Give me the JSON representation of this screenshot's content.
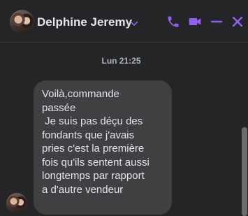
{
  "header": {
    "contact_name": "Delphine Jeremy",
    "accent_color": "#9360f7"
  },
  "icons": {
    "chevron": "chevron-down-icon",
    "call": "phone-icon",
    "video": "video-camera-icon",
    "minimize": "minimize-icon",
    "close": "close-icon"
  },
  "conversation": {
    "timestamp": "Lun 21:25",
    "messages": [
      {
        "sender": "Delphine Jeremy",
        "text": "Voilà,commande\npassée\n Je suis pas déçu des\nfondants que j'avais\npries c'est la première\nfois qu'ils sentent aussi\nlongtemps par rapport\na d'autre vendeur"
      }
    ]
  }
}
